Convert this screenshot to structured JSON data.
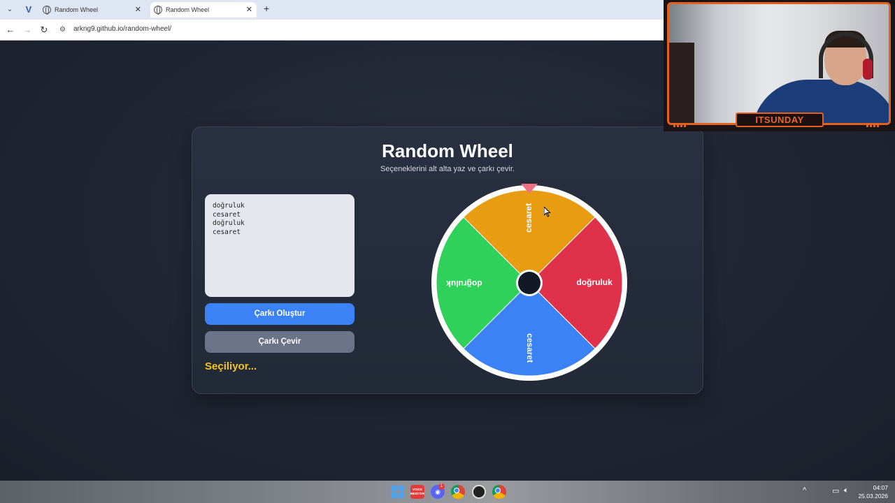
{
  "browser": {
    "tabs": [
      {
        "title": "Random Wheel",
        "active": false
      },
      {
        "title": "Random Wheel",
        "active": true
      }
    ],
    "url": "arkng9.github.io/random-wheel/"
  },
  "app": {
    "title": "Random Wheel",
    "subtitle": "Seçeneklerini alt alta yaz ve çarkı çevir.",
    "options_text": "doğruluk\ncesaret\ndoğruluk\ncesaret",
    "create_button": "Çarkı Oluştur",
    "spin_button": "Çarkı Çevir",
    "status": "Seçiliyor...",
    "wheel": {
      "segments": [
        {
          "label": "cesaret",
          "color": "#e89c12"
        },
        {
          "label": "doğruluk",
          "color": "#e0314a"
        },
        {
          "label": "cesaret",
          "color": "#3b82f6"
        },
        {
          "label": "doğruluk",
          "color": "#2fd15a"
        }
      ],
      "rotation_deg": -45,
      "pointer_color": "#ef6f82",
      "hub_color": "#121826"
    }
  },
  "webcam": {
    "channel_name": "ITSUNDAY"
  },
  "taskbar": {
    "meister_label": "VOICE MEISTER",
    "discord_badge": "1",
    "time": "04:07",
    "date": "25.03.2026"
  }
}
